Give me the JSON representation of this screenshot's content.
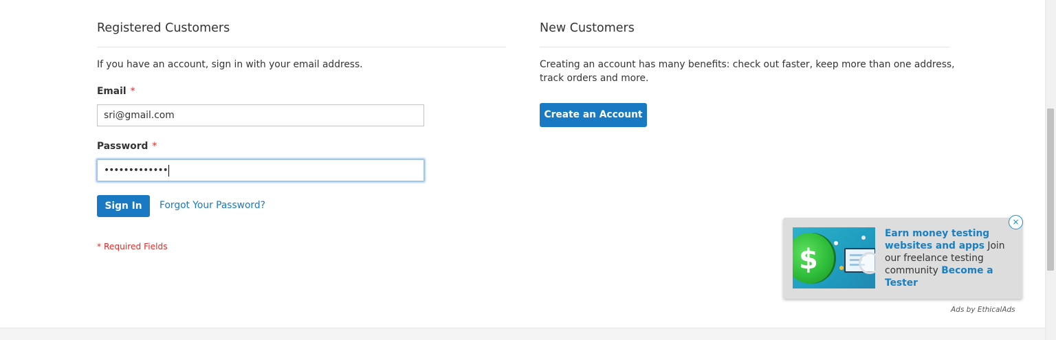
{
  "login": {
    "title": "Registered Customers",
    "intro": "If you have an account, sign in with your email address.",
    "email_label": "Email",
    "email_value": "sri@gmail.com",
    "password_label": "Password",
    "password_value": "•••••••••••••",
    "required_star": "*",
    "sign_in_label": "Sign In",
    "forgot_label": "Forgot Your Password?",
    "required_note": "* Required Fields"
  },
  "new_customers": {
    "title": "New Customers",
    "intro_line1": "Creating an account has many benefits: check out faster, keep more than one address,",
    "intro_line2": "track orders and more.",
    "create_label": "Create an Account"
  },
  "ad": {
    "close_symbol": "×",
    "headline": "Earn money testing websites and apps",
    "body": " Join our freelance testing community ",
    "cta": "Become a Tester",
    "attribution": "Ads by EthicalAds",
    "image_icon": "dollar-coin-icon"
  },
  "colors": {
    "accent": "#1979c3",
    "required": "#e02b27",
    "ad_link": "#1a7fc1"
  }
}
